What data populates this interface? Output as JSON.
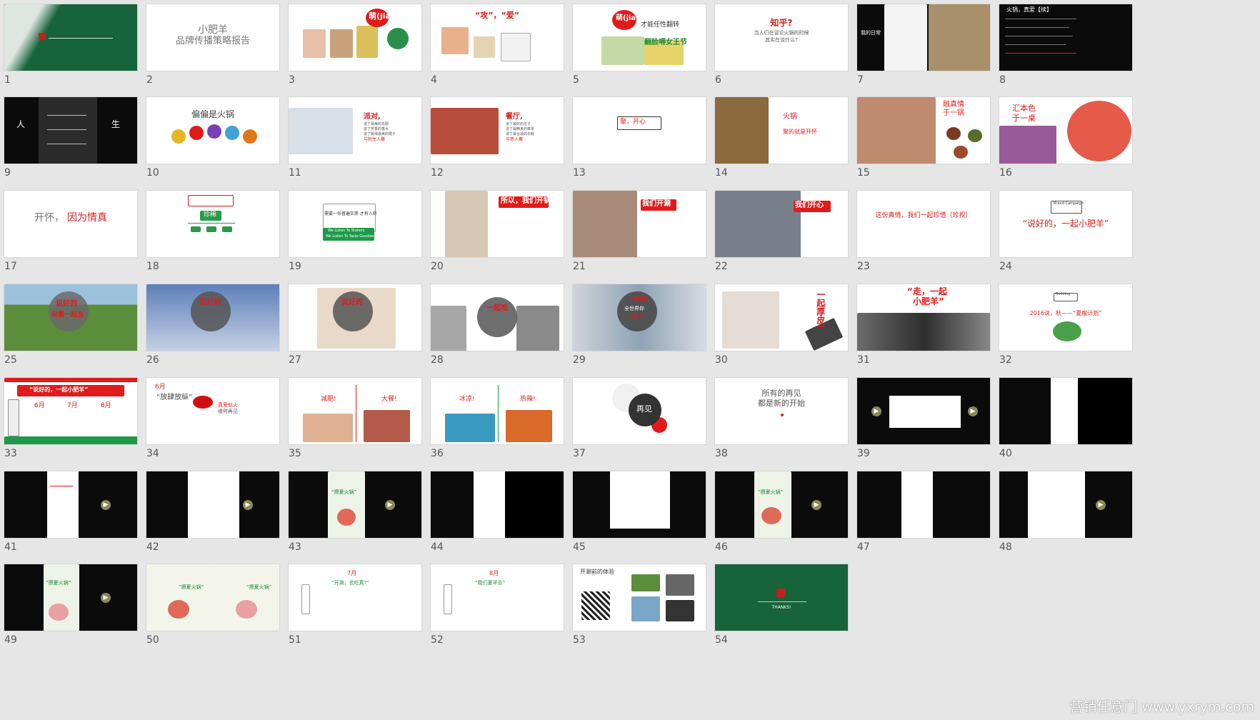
{
  "slides": [
    {
      "number": "1",
      "texts": []
    },
    {
      "number": "2",
      "texts": [
        "小肥羊",
        "品牌传播策略报告"
      ]
    },
    {
      "number": "3",
      "texts": [
        "萌(jian)"
      ]
    },
    {
      "number": "4",
      "texts": [
        "“攻”，“爱”"
      ]
    },
    {
      "number": "5",
      "texts": [
        "萌(jian)人人心",
        "才能任性翻转",
        "翻脸嘚女王节"
      ]
    },
    {
      "number": "6",
      "texts": [
        "知乎?",
        "当人们在谈论火锅的时候",
        "其实在谈什么?"
      ]
    },
    {
      "number": "7",
      "texts": [
        "我的日常"
      ]
    },
    {
      "number": "8",
      "texts": [
        "火锅，真爱【续】"
      ]
    },
    {
      "number": "9",
      "texts": [
        "人",
        "生"
      ]
    },
    {
      "number": "10",
      "texts": [
        "偏偏是火锅"
      ]
    },
    {
      "number": "11",
      "texts": [
        "派对,",
        "进了最美的衣服",
        "进了芳香的香水",
        "进了跑得最美的裙子",
        "与陌生人聚"
      ]
    },
    {
      "number": "12",
      "texts": [
        "餐厅,",
        "进了最好的位子",
        "进了最精良的菜单",
        "进了最合适的衣服",
        "与熟人聚"
      ]
    },
    {
      "number": "13",
      "texts": [
        "聚，开心"
      ]
    },
    {
      "number": "14",
      "texts": [
        "火锅",
        "聚的就是开怀"
      ]
    },
    {
      "number": "15",
      "texts": [
        "融真情",
        "于一锅"
      ]
    },
    {
      "number": "16",
      "texts": [
        "汇本色",
        "于一桌"
      ]
    },
    {
      "number": "17",
      "texts": [
        "开怀，",
        "因为情真"
      ]
    },
    {
      "number": "18",
      "texts": [
        "珍稀"
      ]
    },
    {
      "number": "19",
      "texts": [
        "需要一份普遍实质 才有人听",
        "We Listen To Stakers",
        "We Listen To Taste Goodies"
      ]
    },
    {
      "number": "20",
      "texts": [
        "所以，我们开锅"
      ]
    },
    {
      "number": "21",
      "texts": [
        "我们开涮"
      ]
    },
    {
      "number": "22",
      "texts": [
        "我们开心"
      ]
    },
    {
      "number": "23",
      "texts": [
        "这份真情，我们一起珍惜（珍视）"
      ]
    },
    {
      "number": "24",
      "texts": [
        "Brand Campaign",
        "“说好的，一起小肥羊”"
      ]
    },
    {
      "number": "25",
      "texts": [
        "说好的",
        "何需一起当"
      ]
    },
    {
      "number": "26",
      "texts": [
        "说好的"
      ]
    },
    {
      "number": "27",
      "texts": [
        "说好的"
      ]
    },
    {
      "number": "28",
      "texts": [
        "一起吃"
      ]
    },
    {
      "number": "29",
      "texts": [
        "一起见",
        "全世界你",
        "小肥羊"
      ]
    },
    {
      "number": "30",
      "texts": [
        "一起厚皮!"
      ]
    },
    {
      "number": "31",
      "texts": [
        "“走，一起",
        "小肥羊”"
      ]
    },
    {
      "number": "32",
      "texts": [
        "Building",
        "2016说，秋——“夏瘦计划”"
      ]
    },
    {
      "number": "33",
      "texts": [
        "“说好的，一起小肥羊”",
        "6月",
        "7月",
        "8月"
      ]
    },
    {
      "number": "34",
      "texts": [
        "6月",
        "“放肆放纵”",
        "真爱似火",
        "缘何再见"
      ]
    },
    {
      "number": "35",
      "texts": [
        "减肥!",
        "大餐!"
      ]
    },
    {
      "number": "36",
      "texts": [
        "冰凉!",
        "热辣!"
      ]
    },
    {
      "number": "37",
      "texts": [
        "再见"
      ]
    },
    {
      "number": "38",
      "texts": [
        "所有的再见",
        "都是新的开始"
      ]
    },
    {
      "number": "39",
      "texts": []
    },
    {
      "number": "40",
      "texts": []
    },
    {
      "number": "41",
      "texts": []
    },
    {
      "number": "42",
      "texts": []
    },
    {
      "number": "43",
      "texts": [
        "“撩夏火锅”"
      ]
    },
    {
      "number": "44",
      "texts": []
    },
    {
      "number": "45",
      "texts": []
    },
    {
      "number": "46",
      "texts": [
        "“撩夏火锅”"
      ]
    },
    {
      "number": "47",
      "texts": []
    },
    {
      "number": "48",
      "texts": []
    },
    {
      "number": "49",
      "texts": [
        "“撩夏火锅”"
      ]
    },
    {
      "number": "50",
      "texts": [
        "“撩夏火锅”",
        "“撩夏火锅”"
      ]
    },
    {
      "number": "51",
      "texts": [
        "7月",
        "“开涮，也吃真?”"
      ]
    },
    {
      "number": "52",
      "texts": [
        "8月",
        "“我们夏羊去”"
      ]
    },
    {
      "number": "53",
      "texts": [
        "开涮前的体验"
      ]
    },
    {
      "number": "54",
      "texts": [
        "THANKS!"
      ]
    }
  ],
  "watermark": "营销任意门 www.yxrym.com",
  "colors": {
    "background": "#e6e6e6",
    "accent_red": "#e01b1b",
    "accent_green": "#1f8a3a",
    "dark_green": "#17633a"
  }
}
